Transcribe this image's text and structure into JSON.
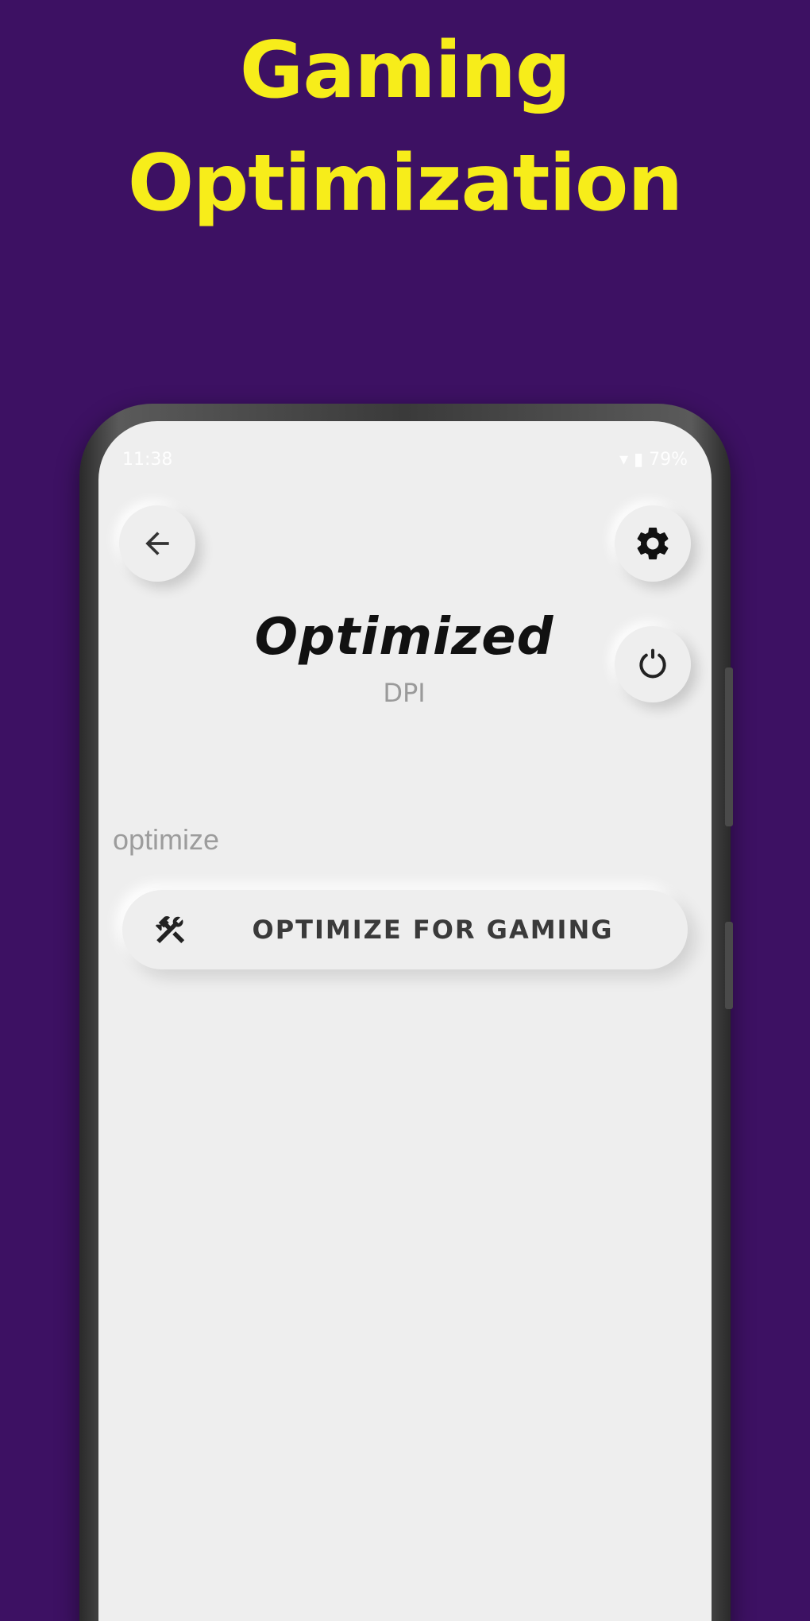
{
  "promo": {
    "title_line1": "Gaming",
    "title_line2": "Optimization",
    "background_color": "#3d1163",
    "title_color": "#f7ed1a"
  },
  "status_bar": {
    "time": "11:38",
    "battery": "79%"
  },
  "toolbar": {
    "back_icon": "arrow-left-icon",
    "settings_icon": "gear-icon",
    "power_icon": "power-icon"
  },
  "header": {
    "title": "Optimized",
    "subtitle": "DPI"
  },
  "section": {
    "label": "optimize"
  },
  "actions": [
    {
      "icon": "hammer-wrench-icon",
      "label": "OPTIMIZE FOR GAMING"
    }
  ],
  "colors": {
    "screen_background": "#eeeeee",
    "title_text": "#111111",
    "muted_text": "#9a9a9a"
  }
}
